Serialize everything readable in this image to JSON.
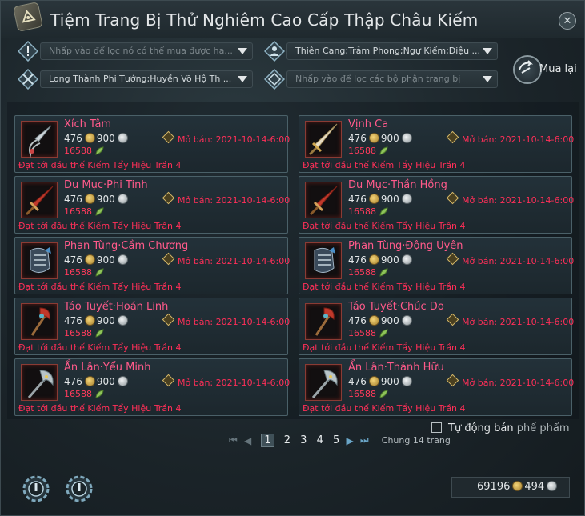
{
  "window": {
    "title": "Tiệm Trang Bị Thử Nghiêm Cao Cấp Thập Châu Kiếm",
    "close_glyph": "✕"
  },
  "filters": {
    "filter1_placeholder": "Nhấp vào để lọc nó có thể  mua được ha...",
    "filter2_value": "Thiên Cang;Trảm Phong;Ngự Kiếm;Diệu ...",
    "filter3_value": "Long Thành Phi Tướng;Huyền Võ Hộ Th ...",
    "filter4_placeholder": "Nhấp vào để lọc các bộ phận trang bị"
  },
  "buyback": {
    "label": "Mua lại"
  },
  "items": [
    {
      "name": "Xích Tâm",
      "price_gold": "476",
      "price_silver": "900",
      "second_price": "16588",
      "sale_label": "Mở bán: 2021-10-14-6:00",
      "requirement": "Đạt tới đầu thế Kiếm Tẩy Hiệu Trần 4",
      "icon": "dagger-icon"
    },
    {
      "name": "Vịnh Ca",
      "price_gold": "476",
      "price_silver": "900",
      "second_price": "16588",
      "sale_label": "Mở bán: 2021-10-14-6:00",
      "requirement": "Đạt tới đầu thế Kiếm Tẩy Hiệu Trần 4",
      "icon": "greatsword-icon"
    },
    {
      "name": "Du Mục·Phi Tinh",
      "price_gold": "476",
      "price_silver": "900",
      "second_price": "16588",
      "sale_label": "Mở bán: 2021-10-14-6:00",
      "requirement": "Đạt tới đầu thế Kiếm Tẩy Hiệu Trần 4",
      "icon": "sword-icon"
    },
    {
      "name": "Du Mục·Thần Hồng",
      "price_gold": "476",
      "price_silver": "900",
      "second_price": "16588",
      "sale_label": "Mở bán: 2021-10-14-6:00",
      "requirement": "Đạt tới đầu thế Kiếm Tẩy Hiệu Trần 4",
      "icon": "sword-icon"
    },
    {
      "name": "Phan Tùng·Cầm Chương",
      "price_gold": "476",
      "price_silver": "900",
      "second_price": "16588",
      "sale_label": "Mở bán: 2021-10-14-6:00",
      "requirement": "Đạt tới đầu thế Kiếm Tẩy Hiệu Trần 4",
      "icon": "gauntlet-icon"
    },
    {
      "name": "Phan Tùng·Động Uyên",
      "price_gold": "476",
      "price_silver": "900",
      "second_price": "16588",
      "sale_label": "Mở bán: 2021-10-14-6:00",
      "requirement": "Đạt tới đầu thế Kiếm Tẩy Hiệu Trần 4",
      "icon": "gauntlet-icon"
    },
    {
      "name": "Táo Tuyết·Hoán Linh",
      "price_gold": "476",
      "price_silver": "900",
      "second_price": "16588",
      "sale_label": "Mở bán: 2021-10-14-6:00",
      "requirement": "Đạt tới đầu thế Kiếm Tẩy Hiệu Trần 4",
      "icon": "staff-icon"
    },
    {
      "name": "Táo Tuyết·Chúc Do",
      "price_gold": "476",
      "price_silver": "900",
      "second_price": "16588",
      "sale_label": "Mở bán: 2021-10-14-6:00",
      "requirement": "Đạt tới đầu thế Kiếm Tẩy Hiệu Trần 4",
      "icon": "staff-icon"
    },
    {
      "name": "Ẩn Lân·Yểu Minh",
      "price_gold": "476",
      "price_silver": "900",
      "second_price": "16588",
      "sale_label": "Mở bán: 2021-10-14-6:00",
      "requirement": "Đạt tới đầu thế Kiếm Tẩy Hiệu Trần 4",
      "icon": "axe-icon"
    },
    {
      "name": "Ẩn Lân·Thánh Hữu",
      "price_gold": "476",
      "price_silver": "900",
      "second_price": "16588",
      "sale_label": "Mở bán: 2021-10-14-6:00",
      "requirement": "Đạt tới đầu thế Kiếm Tẩy Hiệu Trần 4",
      "icon": "axe-icon"
    }
  ],
  "auto_sell": {
    "label": "Tự động bán",
    "suffix": "phế phẩm",
    "checked": false
  },
  "pagination": {
    "pages": [
      "1",
      "2",
      "3",
      "4",
      "5"
    ],
    "current": "1",
    "total_label": "Chung 14 trang"
  },
  "currency": {
    "silver_total": "69196",
    "gold_total": "494"
  },
  "colors": {
    "item_name": "#ff5a8a",
    "warning_red": "#ff2f58",
    "accent_blue": "#6aa6c8"
  }
}
